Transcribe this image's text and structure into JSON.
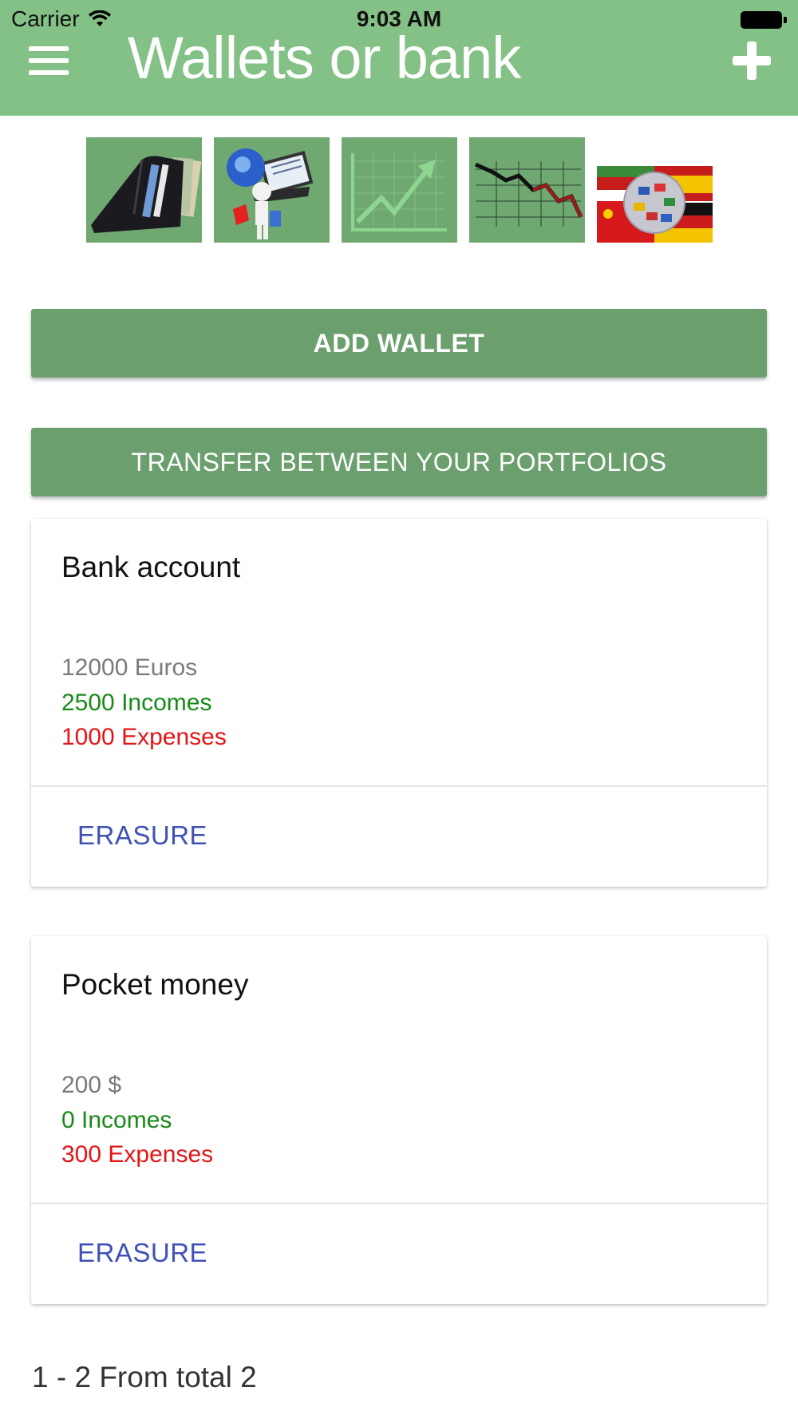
{
  "status": {
    "carrier": "Carrier",
    "time": "9:03 AM"
  },
  "header": {
    "title": "Wallets or bank",
    "menu_icon": "hamburger-menu-icon",
    "add_icon": "plus-icon"
  },
  "icons": [
    "wallet-icon",
    "shopping-globe-icon",
    "growth-chart-icon",
    "decline-chart-icon",
    "currency-flags-icon"
  ],
  "buttons": {
    "add_wallet": "ADD WALLET",
    "transfer": "TRANSFER BETWEEN YOUR PORTFOLIOS"
  },
  "wallets": [
    {
      "name": "Bank account",
      "amount": "12000 Euros",
      "incomes": "2500 Incomes",
      "expenses": "1000 Expenses",
      "action": "ERASURE"
    },
    {
      "name": "Pocket money",
      "amount": "200 $",
      "incomes": "0 Incomes",
      "expenses": "300 Expenses",
      "action": "ERASURE"
    }
  ],
  "pagination": "1 - 2 From total 2",
  "colors": {
    "header": "#84c186",
    "button": "#6c9f6e",
    "income": "#188a18",
    "expense": "#e31515",
    "link": "#3f51b5"
  }
}
